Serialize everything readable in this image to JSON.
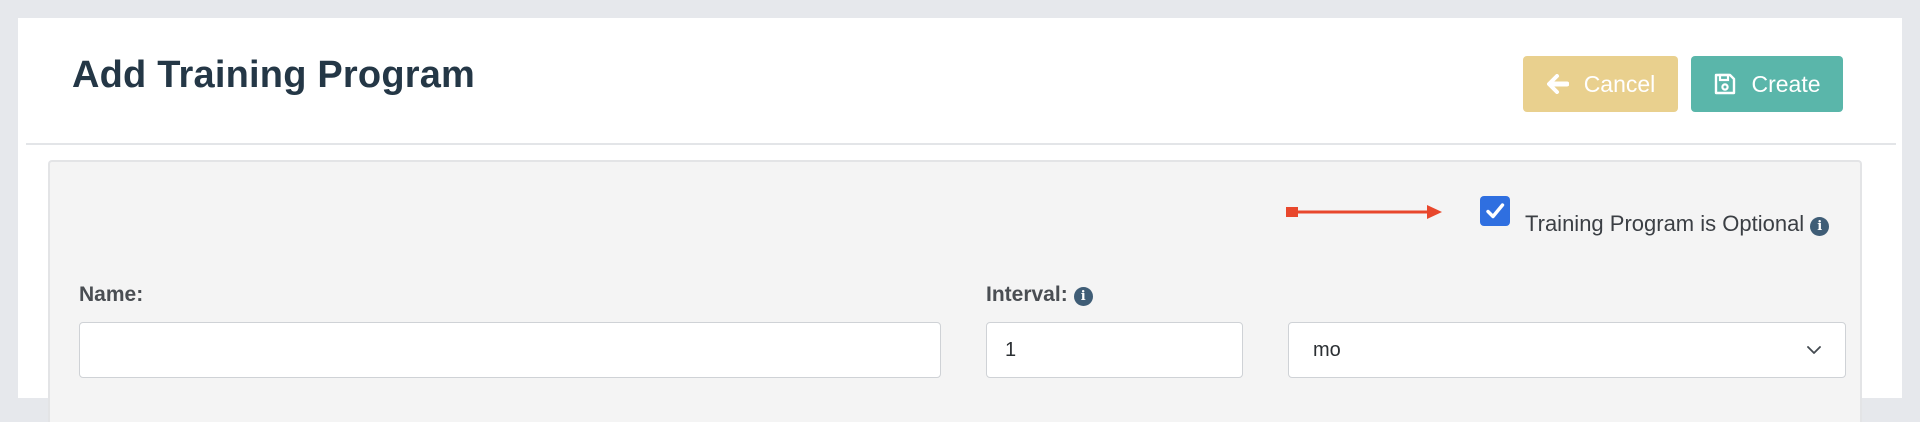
{
  "header": {
    "title": "Add Training Program",
    "cancel_label": "Cancel",
    "create_label": "Create",
    "cancel_color": "#e9d08e",
    "create_color": "#5ab6aa"
  },
  "form": {
    "optional_checkbox": {
      "label": "Training Program is Optional",
      "checked": true,
      "color": "#2f6fe0"
    },
    "name": {
      "label": "Name:",
      "value": "",
      "placeholder": ""
    },
    "interval": {
      "label": "Interval:",
      "value": "1"
    },
    "interval_unit": {
      "selected": "mo"
    }
  },
  "annotation": {
    "arrow_color": "#e8472c"
  },
  "icons": {
    "cancel": "arrow-left-icon",
    "create": "floppy-disk-icon",
    "info": "info-circle-icon",
    "select": "chevron-down-icon"
  }
}
